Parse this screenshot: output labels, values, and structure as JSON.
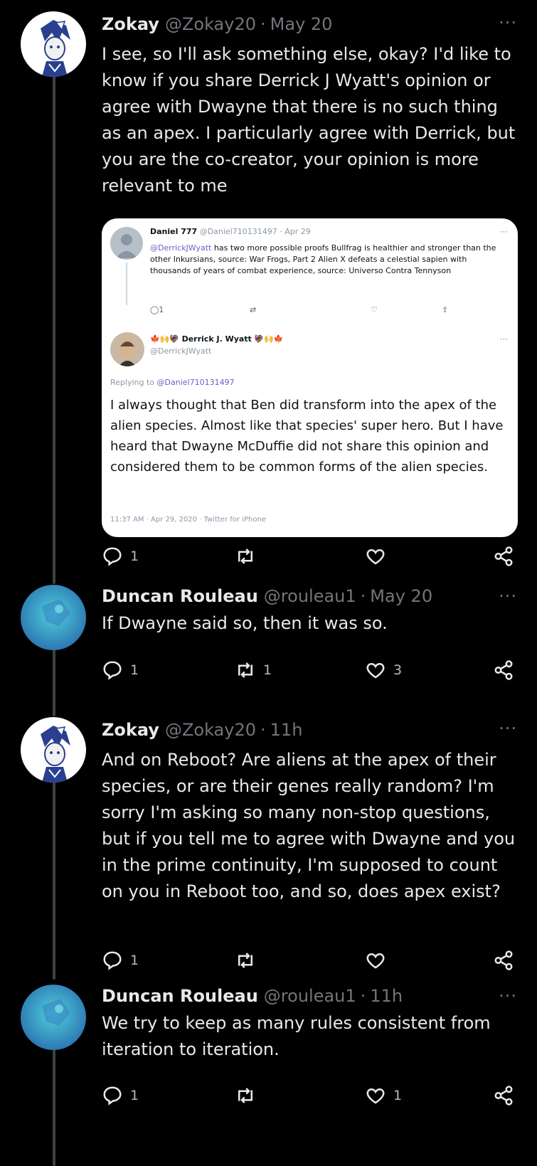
{
  "thread": [
    {
      "name": "Zokay",
      "handle": "@Zokay20",
      "time": "May 20",
      "text": "I see, so I'll ask something else, okay? I'd like to know if you share Derrick J Wyatt's opinion or agree with Dwayne that there is no such thing as an apex. I particularly agree with Derrick, but you are the co-creator, your opinion is more relevant to me",
      "more": "···",
      "avatar": "zokay-avatar",
      "actions": {
        "replies": "1",
        "retweets": "",
        "likes": ""
      }
    },
    {
      "name": "Duncan Rouleau",
      "handle": "@rouleau1",
      "time": "May 20",
      "text": "If Dwayne said so, then it was so.",
      "more": "···",
      "avatar": "duncan-avatar",
      "actions": {
        "replies": "1",
        "retweets": "1",
        "likes": "3"
      }
    },
    {
      "name": "Zokay",
      "handle": "@Zokay20",
      "time": "11h",
      "text": "And on Reboot? Are aliens at the apex of their species, or are their genes really random? I'm sorry I'm asking so many non-stop questions, but if you tell me to agree with Dwayne and you in the prime continuity, I'm supposed to count on you in Reboot too, and so, does apex exist?",
      "more": "···",
      "avatar": "zokay-avatar",
      "actions": {
        "replies": "1",
        "retweets": "",
        "likes": ""
      }
    },
    {
      "name": "Duncan Rouleau",
      "handle": "@rouleau1",
      "time": "11h",
      "text": "We try to keep as many rules consistent from iteration to iteration.",
      "more": "···",
      "avatar": "duncan-avatar",
      "actions": {
        "replies": "1",
        "retweets": "",
        "likes": "1"
      }
    }
  ],
  "quoted_screenshot": {
    "first": {
      "name": "Daniel 777",
      "handle": "@Daniel710131497",
      "time": "Apr 29",
      "more": "···",
      "mention": "@DerrickJWyatt",
      "text": "has two more possible proofs Bullfrag is healthier and stronger than the other Inkursians, source: War Frogs, Part 2 Alien X defeats a celestial sapien with thousands of years of combat experience, source: Universo Contra Tennyson",
      "replies": "1"
    },
    "second": {
      "emoji_left": "🍁🙌🦃",
      "name": "Derrick J. Wyatt",
      "emoji_right": "🦃🙌🍁",
      "handle": "@DerrickJWyatt",
      "more": "···",
      "replying_label": "Replying to",
      "replying_to": "@Daniel710131497",
      "text": "I always thought that Ben did transform into the apex of the alien species. Almost like that species' super hero. But I have heard that Dwayne McDuffie did not share this opinion and considered them to be common forms of the alien species.",
      "footer": "11:37 AM · Apr 29, 2020 · Twitter for iPhone"
    }
  },
  "separator": "·",
  "colors": {
    "background": "#000000",
    "text": "#e7e9ea",
    "muted": "#71767b",
    "thread_line": "#3e4144",
    "avatar_teal": "#2aa4b8"
  }
}
